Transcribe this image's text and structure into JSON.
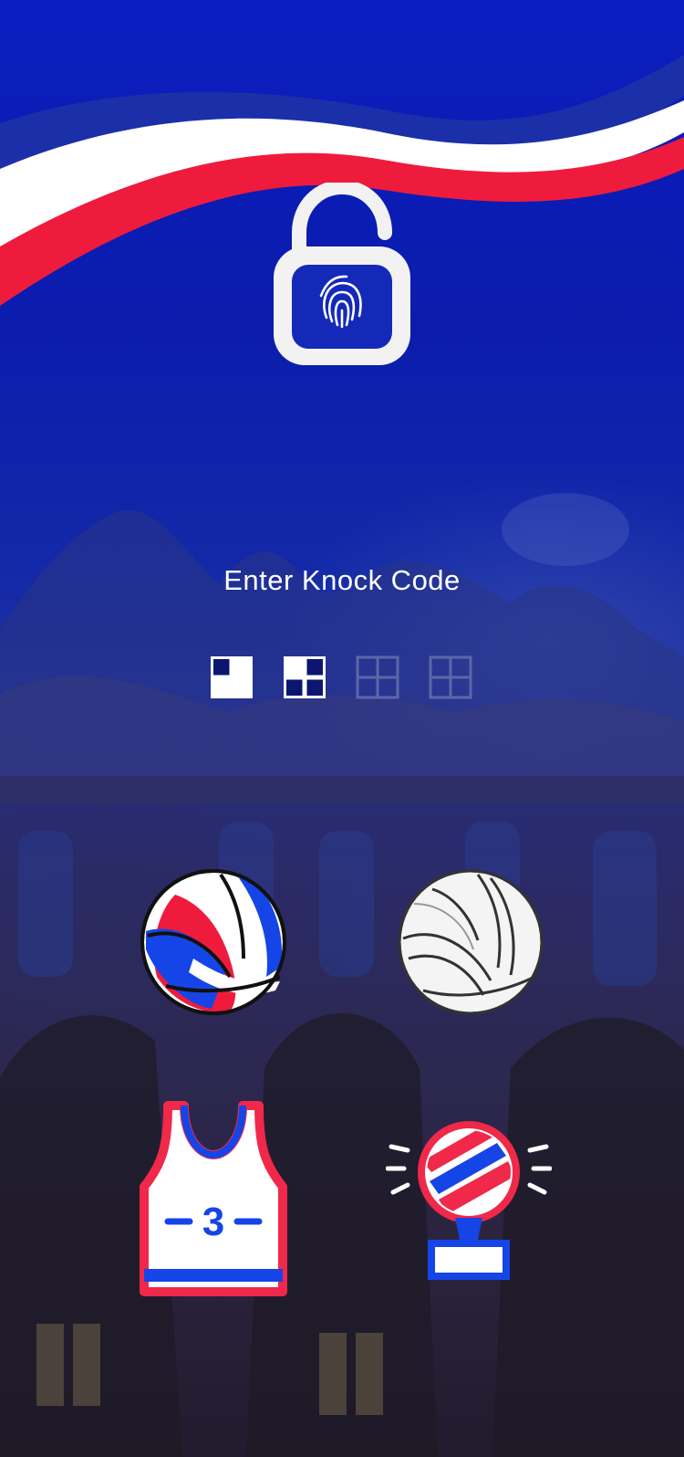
{
  "screen": {
    "title": "Enter Knock Code"
  },
  "colors": {
    "background_blue": "#0b1dbf",
    "flag_red": "#ef1b3d",
    "flag_white": "#ffffff",
    "flag_blue": "#1b2fa8",
    "icon_red": "#f0284a",
    "icon_blue": "#1545e6",
    "lock_white": "#f2f2f2"
  },
  "knock_code": {
    "entered": 2,
    "total": 4,
    "indicators": [
      {
        "state": "filled",
        "pattern": "top-left"
      },
      {
        "state": "filled",
        "pattern": "bottom-left"
      },
      {
        "state": "empty",
        "pattern": "none"
      },
      {
        "state": "empty",
        "pattern": "none"
      }
    ]
  },
  "keypad": {
    "buttons": [
      {
        "icon": "volleyball-color-icon"
      },
      {
        "icon": "volleyball-white-icon"
      },
      {
        "icon": "jersey-icon",
        "number": "3"
      },
      {
        "icon": "trophy-icon"
      }
    ]
  }
}
